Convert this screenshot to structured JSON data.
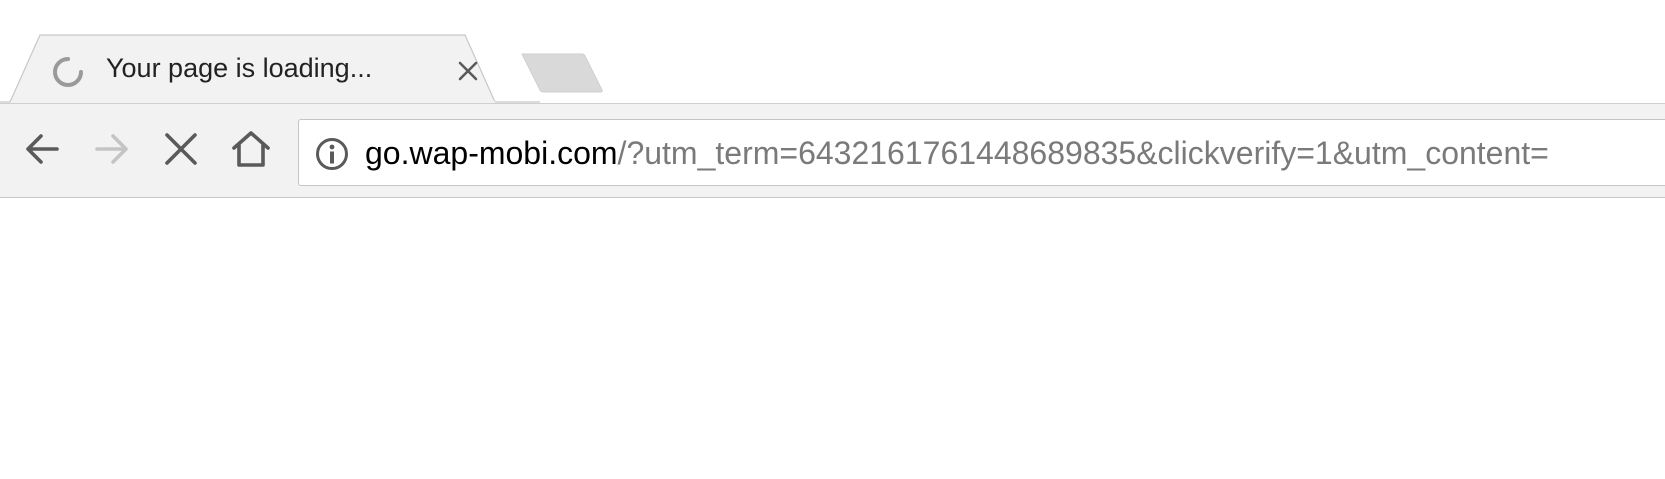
{
  "tab": {
    "title": "Your page is loading...",
    "status": "loading"
  },
  "toolbar": {
    "back": {
      "icon": "arrow-left-icon",
      "enabled": true
    },
    "forward": {
      "icon": "arrow-right-icon",
      "enabled": false
    },
    "stop": {
      "icon": "close-x-icon",
      "enabled": true
    },
    "home": {
      "icon": "home-icon",
      "enabled": true
    }
  },
  "omnibox": {
    "security_icon": "info-circle-icon",
    "url_host": "go.wap-mobi.com",
    "url_rest": "/?utm_term=6432161761448689835&clickverify=1&utm_content="
  },
  "colors": {
    "toolbar_bg": "#f2f2f2",
    "tab_bg": "#f2f2f2",
    "inactive_tab": "#d9d9d9",
    "url_host": "#000000",
    "url_rest": "#7a7a7a"
  }
}
